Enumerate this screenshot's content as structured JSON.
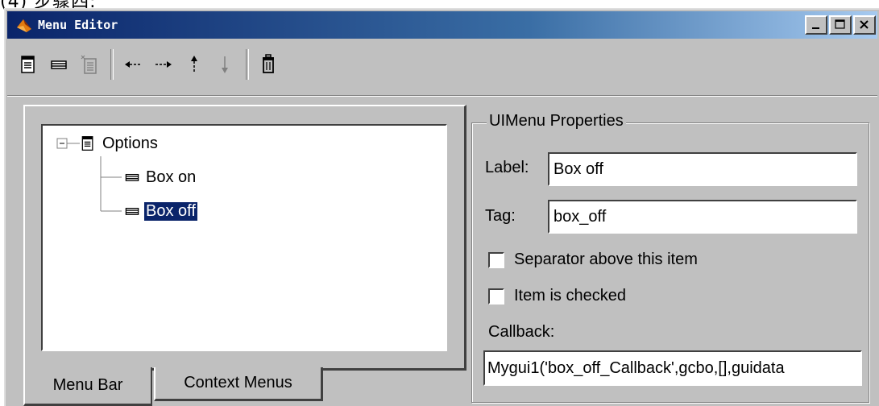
{
  "crop_text": "(4) 步骤四:",
  "window": {
    "title": "Menu Editor"
  },
  "icons": {
    "app": "matlab-icon",
    "minimize": "minimize-icon",
    "maximize": "maximize-icon",
    "close": "close-icon",
    "toolbar": [
      "new-menu-icon",
      "new-menu-item-icon",
      "new-context-menu-icon",
      "move-left-icon",
      "move-right-icon",
      "move-up-icon",
      "move-down-icon",
      "delete-icon"
    ]
  },
  "tree": {
    "root": {
      "label": "Options",
      "expander": "⊟"
    },
    "items": [
      {
        "label": "Box on"
      },
      {
        "label": "Box off"
      }
    ]
  },
  "tabs": [
    {
      "label": "Menu Bar"
    },
    {
      "label": "Context Menus"
    }
  ],
  "properties": {
    "group_title": "UIMenu Properties",
    "label_caption": "Label:",
    "label_value": "Box off",
    "tag_caption": "Tag:",
    "tag_value": "box_off",
    "separator_label": "Separator above this item",
    "checked_label": "Item is checked",
    "callback_caption": "Callback:",
    "callback_value": "Mygui1('box_off_Callback',gcbo,[],guidata"
  },
  "colors": {
    "selection": "#0a246a",
    "face": "#c0c0c0"
  }
}
